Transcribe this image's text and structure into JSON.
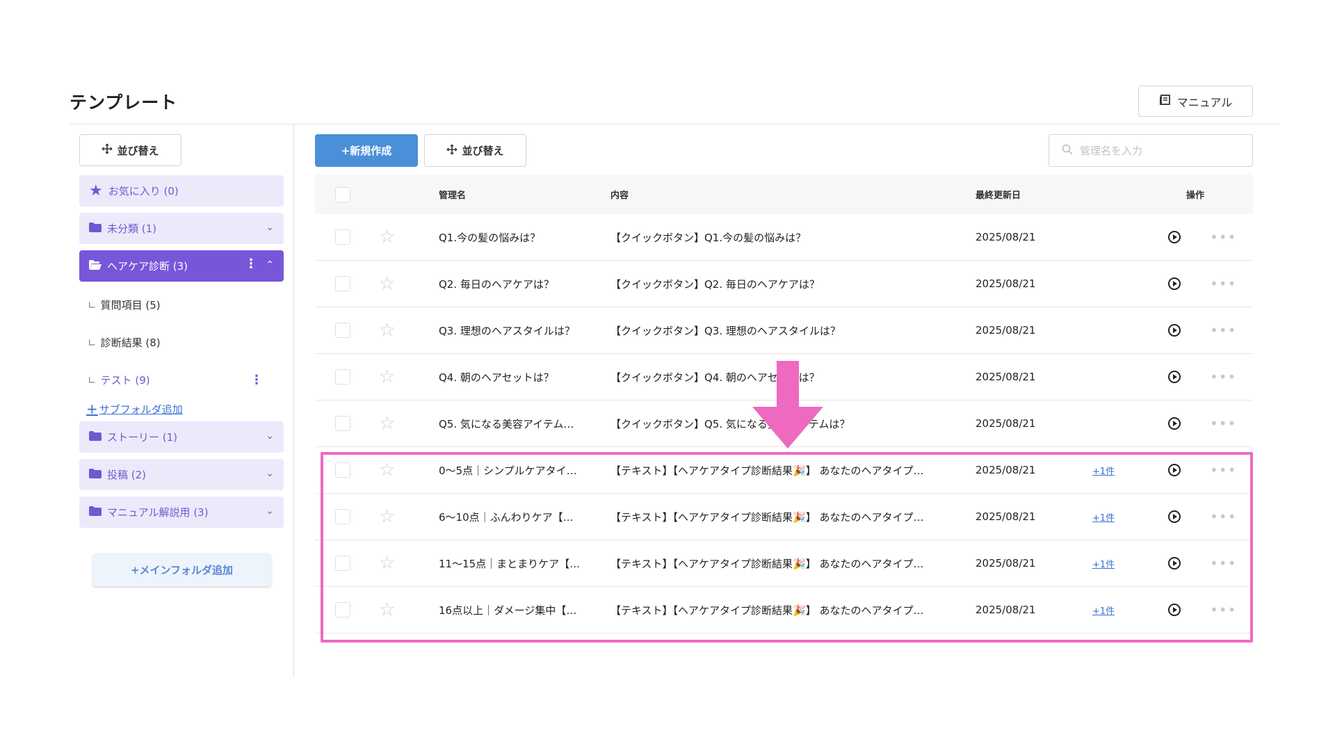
{
  "page": {
    "title": "テンプレート",
    "manual_label": "マニュアル"
  },
  "sidebar": {
    "sort_label": "並び替え",
    "folders": [
      {
        "label": "お気に入り (0)",
        "icon": "star-icon"
      },
      {
        "label": "未分類 (1)",
        "icon": "folder-icon"
      },
      {
        "label": "ヘアケア診断 (3)",
        "icon": "folder-open-icon",
        "active": true
      },
      {
        "label": "ストーリー (1)",
        "icon": "folder-icon"
      },
      {
        "label": "投稿 (2)",
        "icon": "folder-icon"
      },
      {
        "label": "マニュアル解説用 (3)",
        "icon": "folder-icon"
      }
    ],
    "subfolders": [
      {
        "label": "質問項目 (5)"
      },
      {
        "label": "診断結果 (8)"
      },
      {
        "label": "テスト (9)"
      }
    ],
    "add_subfolder_label": "サブフォルダ追加",
    "add_main_folder_label": "+メインフォルダ追加"
  },
  "toolbar": {
    "new_label": "+新規作成",
    "sort_label": "並び替え",
    "search_placeholder": "管理名を入力"
  },
  "table": {
    "headers": {
      "name": "管理名",
      "content": "内容",
      "updated": "最終更新日",
      "ops": "操作"
    },
    "rows": [
      {
        "name": "Q1.今の髪の悩みは？",
        "content": "【クイックボタン】Q1.今の髪の悩みは？",
        "date": "2025/08/21",
        "extra": ""
      },
      {
        "name": "Q2. 毎日のヘアケアは？",
        "content": "【クイックボタン】Q2. 毎日のヘアケアは？",
        "date": "2025/08/21",
        "extra": ""
      },
      {
        "name": "Q3. 理想のヘアスタイルは？",
        "content": "【クイックボタン】Q3. 理想のヘアスタイルは？",
        "date": "2025/08/21",
        "extra": ""
      },
      {
        "name": "Q4. 朝のヘアセットは？",
        "content": "【クイックボタン】Q4. 朝のヘアセットは？",
        "date": "2025/08/21",
        "extra": ""
      },
      {
        "name": "Q5. 気になる美容アイテム…",
        "content": "【クイックボタン】Q5. 気になる美容アイテムは？",
        "date": "2025/08/21",
        "extra": ""
      },
      {
        "name": "0〜5点｜シンプルケアタイ…",
        "content": "【テキスト】【ヘアケアタイプ診断結果🎉】 あなたのヘアタイプ…",
        "date": "2025/08/21",
        "extra": "+1件"
      },
      {
        "name": "6〜10点｜ふんわりケア【…",
        "content": "【テキスト】【ヘアケアタイプ診断結果🎉】 あなたのヘアタイプ…",
        "date": "2025/08/21",
        "extra": "+1件"
      },
      {
        "name": "11〜15点｜まとまりケア【…",
        "content": "【テキスト】【ヘアケアタイプ診断結果🎉】 あなたのヘアタイプ…",
        "date": "2025/08/21",
        "extra": "+1件"
      },
      {
        "name": "16点以上｜ダメージ集中【…",
        "content": "【テキスト】【ヘアケアタイプ診断結果🎉】 あなたのヘアタイプ…",
        "date": "2025/08/21",
        "extra": "+1件"
      }
    ]
  },
  "colors": {
    "accent_purple": "#7856d9",
    "folder_bg": "#ede9fb",
    "primary_blue": "#4a90d9",
    "annotation_pink": "#ee6ac0"
  }
}
